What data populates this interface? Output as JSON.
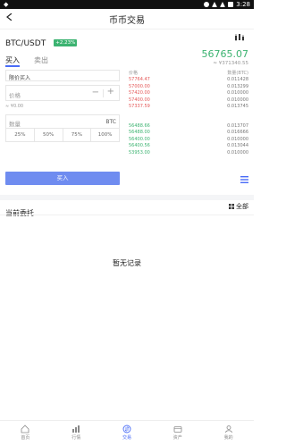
{
  "status_bar": {
    "time": "3:28"
  },
  "header": {
    "title": "币币交易"
  },
  "pair": {
    "name": "BTC/USDT",
    "change": "+2.23%"
  },
  "ticker": {
    "price": "56765.07",
    "cny": "≈ ¥371340.55"
  },
  "tabs": [
    {
      "label": "买入",
      "active": true
    },
    {
      "label": "卖出",
      "active": false
    }
  ],
  "form": {
    "order_type": "限价买入",
    "price_placeholder": "价格",
    "price_approx": "≈ ¥0.00",
    "qty_placeholder": "数量",
    "qty_unit": "BTC",
    "percents": [
      "25%",
      "50%",
      "75%",
      "100%"
    ],
    "available": "",
    "buy_label": "买入"
  },
  "orderbook": {
    "head_price": "价格",
    "head_qty": "数量(BTC)",
    "asks": [
      {
        "price": "57764.47",
        "qty": "0.011428"
      },
      {
        "price": "57000.00",
        "qty": "0.013299"
      },
      {
        "price": "57420.00",
        "qty": "0.010000"
      },
      {
        "price": "57400.00",
        "qty": "0.010000"
      },
      {
        "price": "57337.59",
        "qty": "0.013745"
      }
    ],
    "bids": [
      {
        "price": "56488.66",
        "qty": "0.013707"
      },
      {
        "price": "56488.00",
        "qty": "0.016666"
      },
      {
        "price": "56400.00",
        "qty": "0.010000"
      },
      {
        "price": "56400.56",
        "qty": "0.013044"
      },
      {
        "price": "53953.00",
        "qty": "0.010000"
      }
    ]
  },
  "orders": {
    "title": "当前委托",
    "all_label": "全部",
    "empty_text": "暂无记录"
  },
  "nav": [
    {
      "label": "首页",
      "icon": "home-icon",
      "active": false
    },
    {
      "label": "行情",
      "icon": "chart-icon",
      "active": false
    },
    {
      "label": "交易",
      "icon": "exchange-icon",
      "active": true
    },
    {
      "label": "资产",
      "icon": "wallet-icon",
      "active": false
    },
    {
      "label": "我的",
      "icon": "user-icon",
      "active": false
    }
  ],
  "colors": {
    "accent": "#4a6cf7",
    "up": "#3cb371",
    "down": "#e45858",
    "button": "#6f8cf0"
  }
}
